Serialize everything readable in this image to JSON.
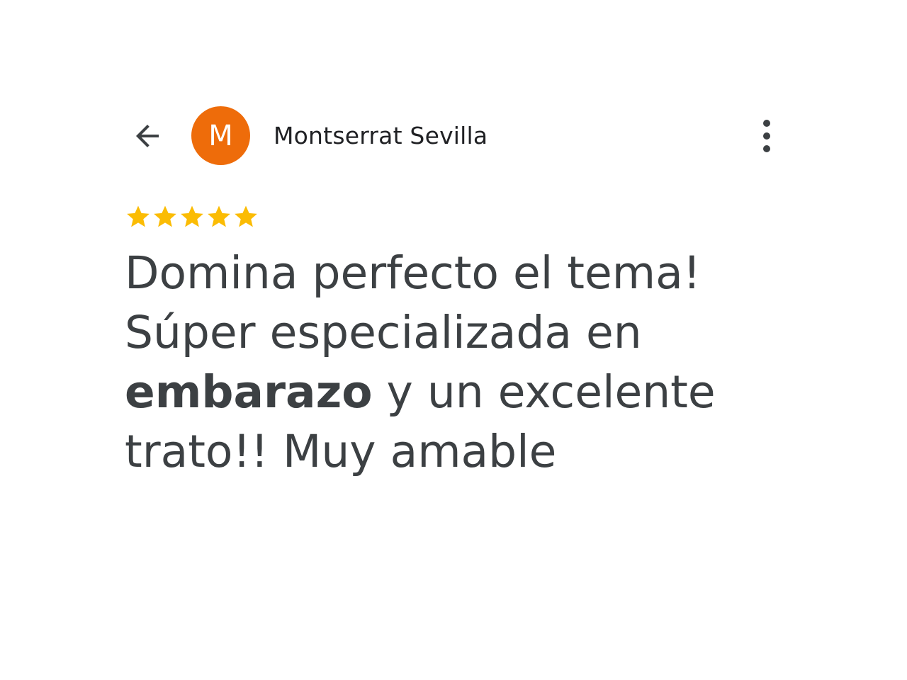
{
  "header": {
    "back_icon": "arrow-back-icon",
    "avatar_initial": "M",
    "avatar_color": "#ee6c0a",
    "reviewer_name": "Montserrat Sevilla",
    "more_icon": "more-vert-icon"
  },
  "review": {
    "rating": 5,
    "max_rating": 5,
    "star_color": "#fbbc04",
    "text_lines": [
      {
        "parts": [
          {
            "text": "Domina perfecto el tema!",
            "bold": false
          }
        ]
      },
      {
        "parts": [
          {
            "text": "Súper especializada en",
            "bold": false
          }
        ]
      },
      {
        "parts": [
          {
            "text": "embarazo",
            "bold": true
          },
          {
            "text": " y un excelente",
            "bold": false
          }
        ]
      },
      {
        "parts": [
          {
            "text": "trato!! Muy amable",
            "bold": false
          }
        ]
      }
    ]
  },
  "colors": {
    "text_primary": "#202124",
    "text_body": "#3c4043",
    "icon": "#3c4043"
  }
}
